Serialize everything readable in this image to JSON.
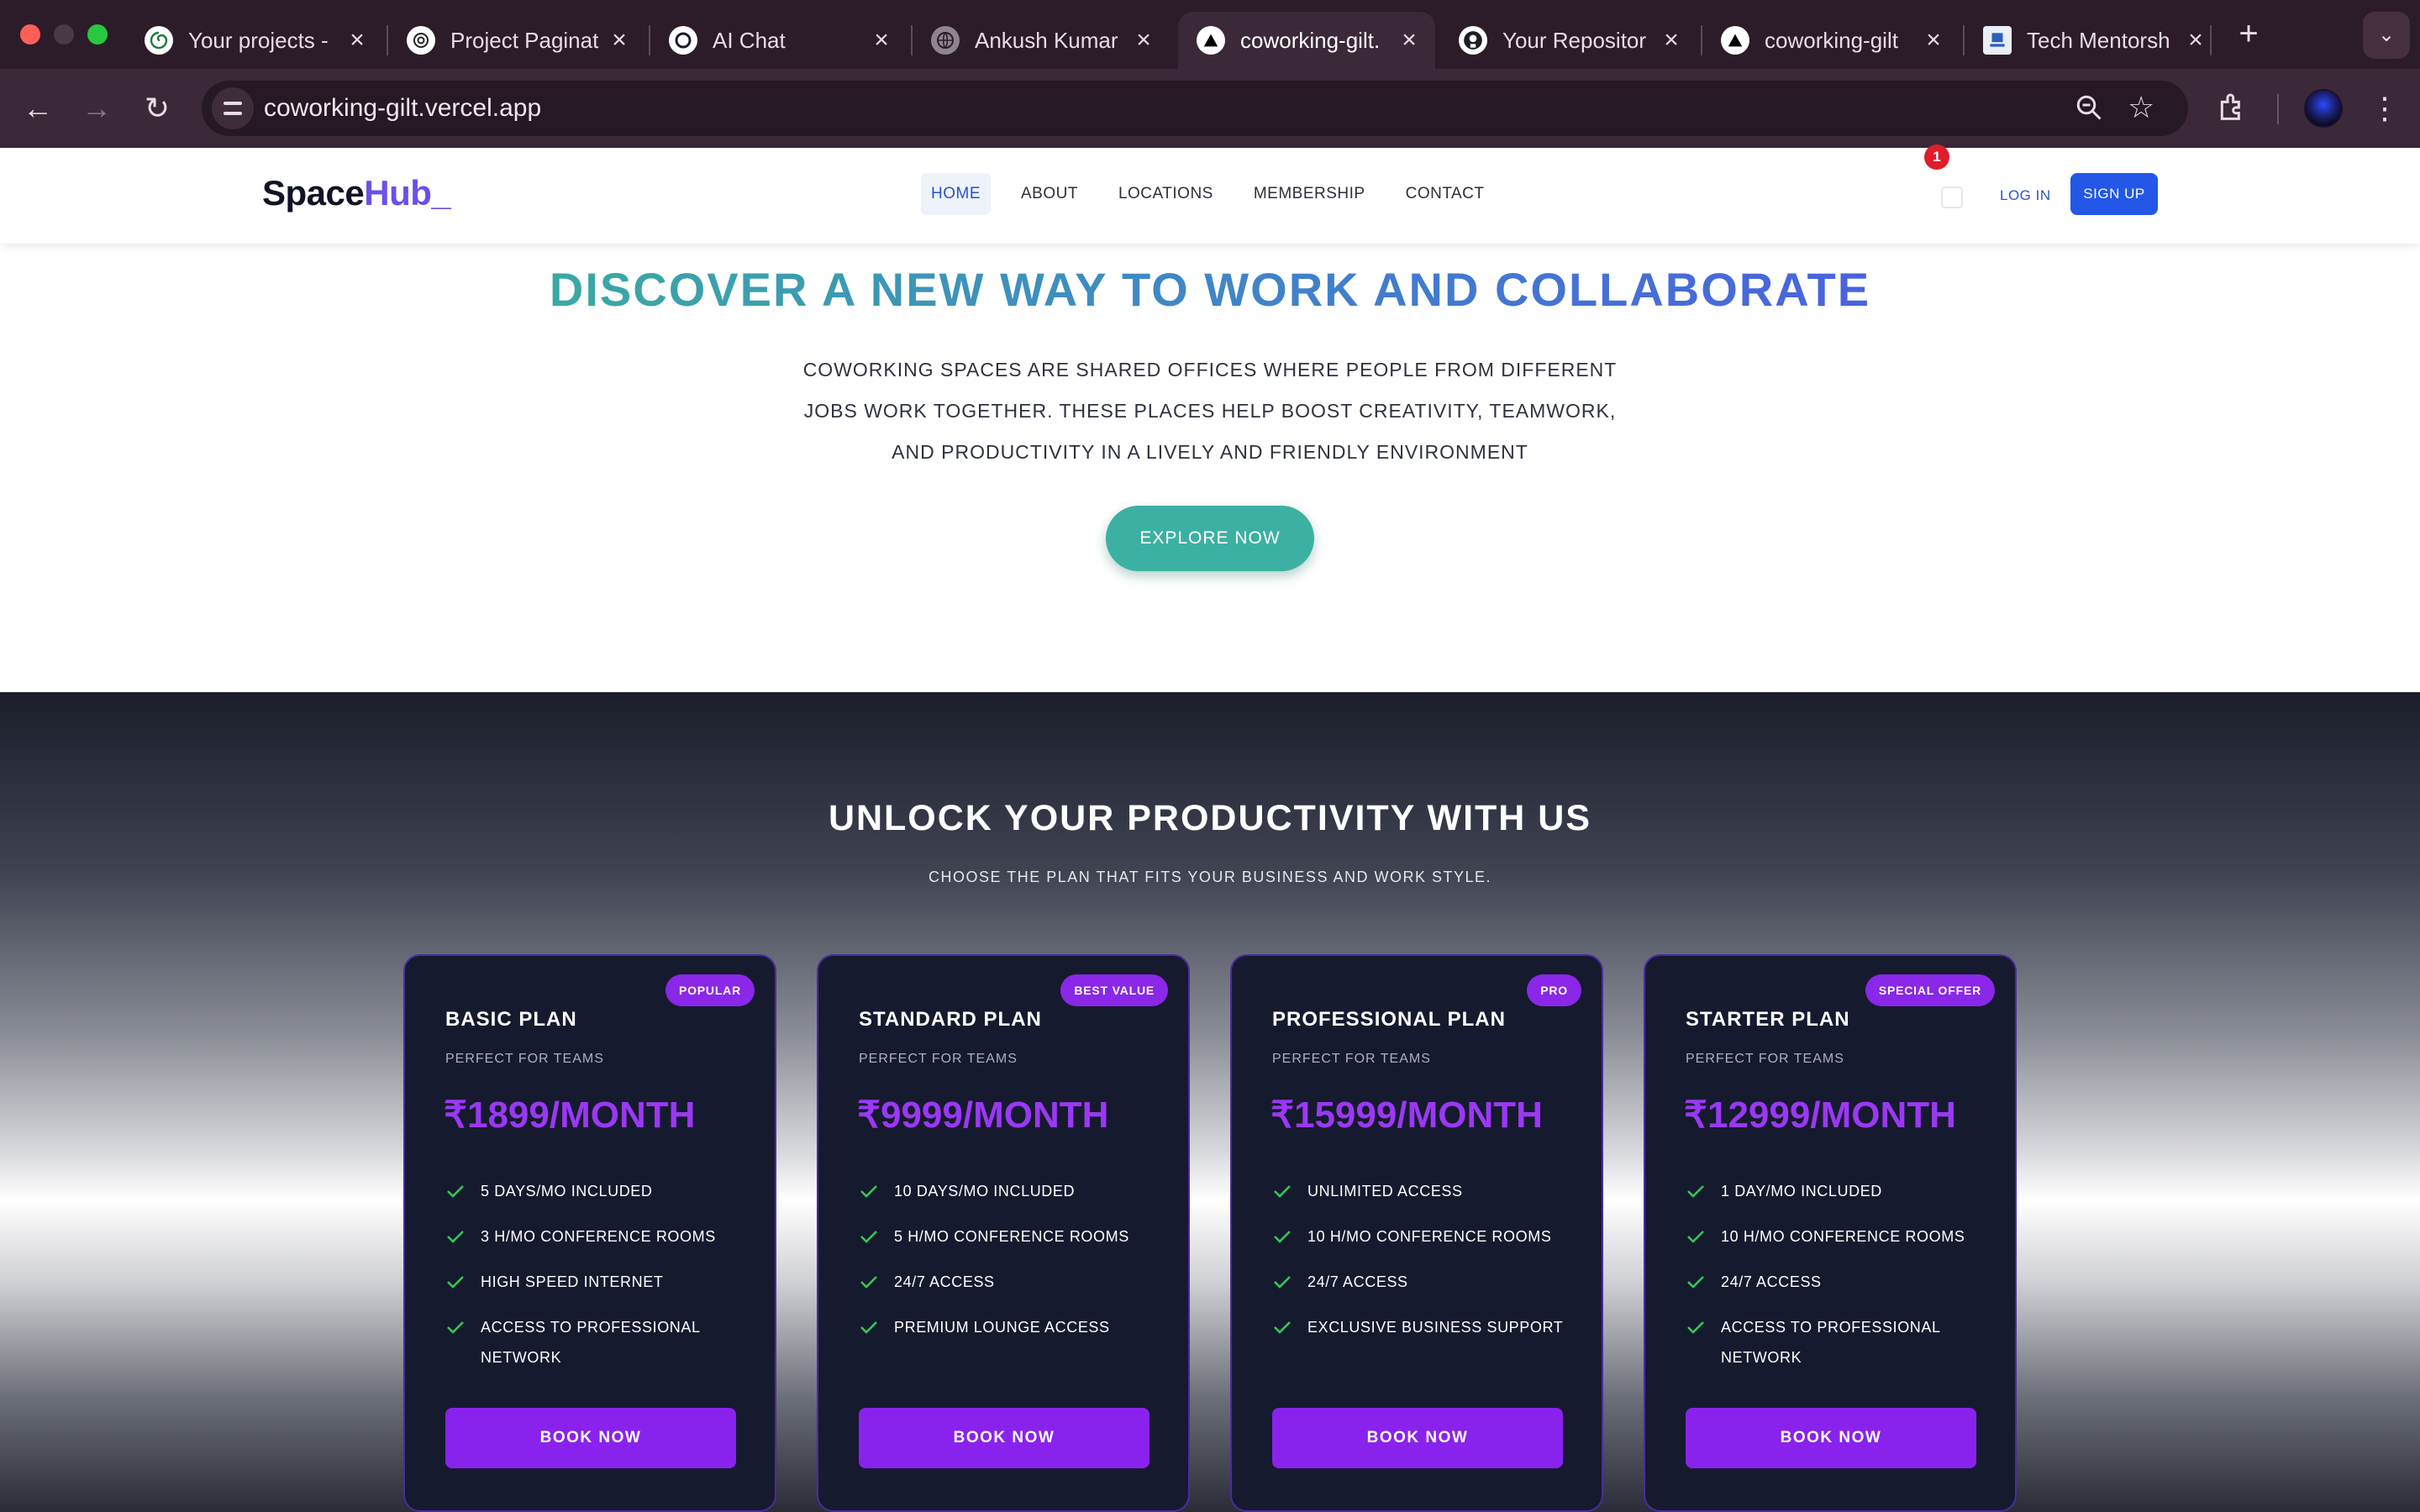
{
  "browser": {
    "tabs": [
      {
        "title": "Your projects -",
        "icon": "spiral-icon"
      },
      {
        "title": "Project Paginat",
        "icon": "openai-icon"
      },
      {
        "title": "AI Chat",
        "icon": "swirl-icon"
      },
      {
        "title": "Ankush Kumar",
        "icon": "globe-icon"
      },
      {
        "title": "coworking-gilt.",
        "icon": "vercel-icon"
      },
      {
        "title": "Your Repositor",
        "icon": "github-icon"
      },
      {
        "title": "coworking-gilt",
        "icon": "vercel-icon"
      },
      {
        "title": "Tech Mentorsh",
        "icon": "tech-logo-icon"
      }
    ],
    "active_tab": 4,
    "url": "coworking-gilt.vercel.app"
  },
  "site": {
    "logo": {
      "part1": "Space",
      "part2": "Hub_"
    },
    "nav": [
      "HOME",
      "ABOUT",
      "LOCATIONS",
      "MEMBERSHIP",
      "CONTACT"
    ],
    "active_nav": "HOME",
    "cart_count": "1",
    "login_label": "LOG IN",
    "signup_label": "SIGN UP"
  },
  "hero": {
    "title": "DISCOVER A NEW WAY TO WORK AND COLLABORATE",
    "description": "COWORKING SPACES ARE SHARED OFFICES WHERE PEOPLE FROM DIFFERENT JOBS WORK TOGETHER. THESE PLACES HELP BOOST CREATIVITY, TEAMWORK, AND PRODUCTIVITY IN A LIVELY AND FRIENDLY ENVIRONMENT",
    "cta": "EXPLORE NOW"
  },
  "pricing": {
    "title": "UNLOCK YOUR PRODUCTIVITY WITH US",
    "subtitle": "CHOOSE THE PLAN THAT FITS YOUR BUSINESS AND WORK STYLE.",
    "plans": [
      {
        "badge": "POPULAR",
        "name": "BASIC PLAN",
        "tagline": "PERFECT FOR TEAMS",
        "price": "₹1899/MONTH",
        "features": [
          "5 DAYS/MO INCLUDED",
          "3 H/MO CONFERENCE ROOMS",
          "HIGH SPEED INTERNET",
          "ACCESS TO PROFESSIONAL NETWORK"
        ],
        "cta": "BOOK NOW"
      },
      {
        "badge": "BEST VALUE",
        "name": "STANDARD PLAN",
        "tagline": "PERFECT FOR TEAMS",
        "price": "₹9999/MONTH",
        "features": [
          "10 DAYS/MO INCLUDED",
          "5 H/MO CONFERENCE ROOMS",
          "24/7 ACCESS",
          "PREMIUM LOUNGE ACCESS"
        ],
        "cta": "BOOK NOW"
      },
      {
        "badge": "PRO",
        "name": "PROFESSIONAL PLAN",
        "tagline": "PERFECT FOR TEAMS",
        "price": "₹15999/MONTH",
        "features": [
          "UNLIMITED ACCESS",
          "10 H/MO CONFERENCE ROOMS",
          "24/7 ACCESS",
          "EXCLUSIVE BUSINESS SUPPORT"
        ],
        "cta": "BOOK NOW"
      },
      {
        "badge": "SPECIAL OFFER",
        "name": "STARTER PLAN",
        "tagline": "PERFECT FOR TEAMS",
        "price": "₹12999/MONTH",
        "features": [
          "1 DAY/MO INCLUDED",
          "10 H/MO CONFERENCE ROOMS",
          "24/7 ACCESS",
          "ACCESS TO PROFESSIONAL NETWORK"
        ],
        "cta": "BOOK NOW"
      }
    ]
  },
  "colors": {
    "accent_purple": "#8a22ee",
    "brand_blue": "#2357e8",
    "teal_cta": "#3cb1a3",
    "card_bg": "#161a2e",
    "check_green": "#34c759",
    "badge_red": "#e11d2a"
  }
}
